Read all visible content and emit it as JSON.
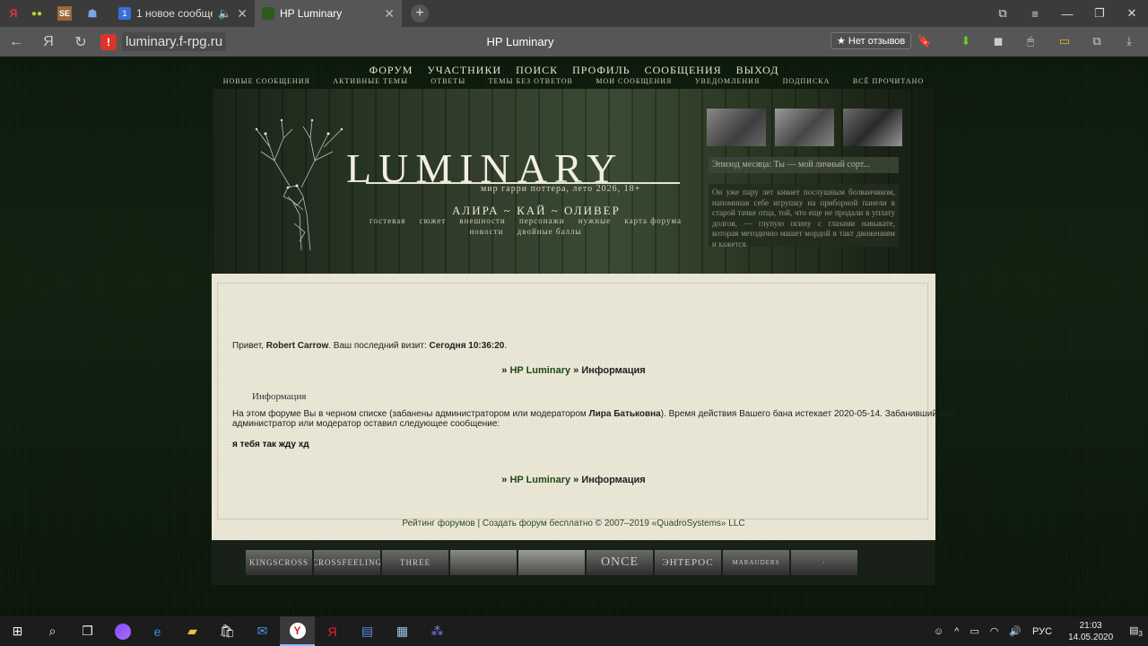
{
  "browser": {
    "tabs": [
      {
        "title": "1 новое сообщени",
        "color": "#3a6fd8",
        "badge": "1"
      },
      {
        "title": "HP Luminary",
        "color": "#2e5a20"
      }
    ],
    "pinned": [
      "Я",
      "●●",
      "SE",
      "☗"
    ],
    "new_tab": "+",
    "url": "luminary.f-rpg.ru",
    "page_title": "HP Luminary",
    "reviews_label": "Нет отзывов",
    "warning_icon": "!",
    "window_controls": [
      "⧉",
      "≡",
      "—",
      "❐",
      "✕"
    ],
    "nav": {
      "back": "←",
      "yandex": "Я",
      "reload": "↻"
    },
    "extensions": [
      "🔖",
      "⬇",
      "◼",
      "🖱",
      "▭",
      "⧉",
      "⤓"
    ]
  },
  "forum": {
    "top_nav": [
      "ФОРУМ",
      "УЧАСТНИКИ",
      "ПОИСК",
      "ПРОФИЛЬ",
      "СООБЩЕНИЯ",
      "ВЫХОД"
    ],
    "sub_nav": [
      "НОВЫЕ СООБЩЕНИЯ",
      "АКТИВНЫЕ ТЕМЫ",
      "ОТВЕТЫ",
      "ТЕМЫ БЕЗ ОТВЕТОВ",
      "МОИ СООБЩЕНИЯ",
      "УВЕДОМЛЕНИЯ",
      "ПОДПИСКА",
      "ВСЁ ПРОЧИТАНО"
    ],
    "banner": {
      "logo": "LUMINARY",
      "subtitle": "мир гарри поттера, лето 2026, 18+",
      "names": "АЛИРА ~ КАЙ ~ ОЛИВЕР",
      "links_row1": [
        "гостевая",
        "сюжет",
        "внешности",
        "персонажи",
        "нужные",
        "карта форума"
      ],
      "links_row2": [
        "новости",
        "двойные баллы"
      ],
      "episode": "Эпизод месяца: Ты — мой личный сорт...",
      "excerpt": "Он уже пару лет кивает послушным болванчиком, напоминая себе игрушку на приборной панели в старой тачке отца, той, что еще не продали в уплату долгов, — глупую псину с глазами навыкате, которая методично машет мордой в такт движениям и кажется,"
    },
    "greeting": {
      "prefix": "Привет, ",
      "user": "Robert Carrow",
      "mid": ".  Ваш последний визит: ",
      "last_visit": "Сегодня 10:36:20",
      "suffix": "."
    },
    "breadcrumb": {
      "sep": "»",
      "forum": "HP Luminary",
      "page": "Информация"
    },
    "info_heading": "Информация",
    "ban": {
      "before": "На этом форуме Вы в черном списке (забанены администратором или модератором ",
      "moderator": "Лира Батьковна",
      "after": "). Время действия Вашего бана истекает 2020-05-14. Забанивший Вас администратор или модератор оставил следующее сообщение:",
      "message": "я тебя так жду хд"
    },
    "footer": {
      "rating": "Рейтинг форумов",
      "sep": " | ",
      "create": "Создать форум бесплатно",
      "copyright": " © 2007–2019 «QuadroSystems» LLC"
    },
    "affiliates": [
      "KINGSCROSS",
      "CROSSFEELING",
      "THREE",
      "",
      "",
      "ONCE",
      "ЭНТЕРОС",
      "MARAUDERS",
      "·"
    ]
  },
  "taskbar": {
    "icons": [
      "start-icon",
      "search-icon",
      "task-view-icon",
      "alice-icon",
      "edge-icon",
      "explorer-icon",
      "store-icon",
      "mail-icon",
      "yandex-browser-icon",
      "yandex-icon",
      "word-icon",
      "notepad-icon",
      "teams-icon"
    ],
    "lang": "РУС",
    "time": "21:03",
    "date": "14.05.2020",
    "notifications": "3"
  }
}
